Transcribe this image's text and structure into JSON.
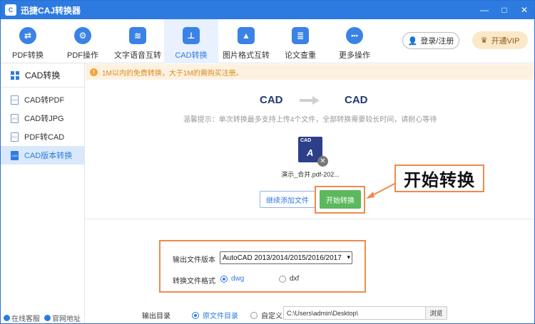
{
  "app": {
    "title": "迅捷CAJ转换器",
    "logo": "C"
  },
  "window": {
    "minimize": "—",
    "maximize": "□",
    "close": "✕"
  },
  "toolbar": {
    "tabs": [
      {
        "label": "PDF转换",
        "icon": "⇄"
      },
      {
        "label": "PDF操作",
        "icon": "⚙"
      },
      {
        "label": "文字语音互转",
        "icon": "≋"
      },
      {
        "label": "CAD转换",
        "icon": "⊥"
      },
      {
        "label": "图片格式互转",
        "icon": "▲"
      },
      {
        "label": "论文查重",
        "icon": "≣"
      },
      {
        "label": "更多操作",
        "icon": "•••"
      }
    ],
    "login": "登录/注册",
    "vip": "开通VIP"
  },
  "sidebar": {
    "header": "CAD转换",
    "items": [
      {
        "label": "CAD转PDF",
        "badge": "PDF"
      },
      {
        "label": "CAD转JPG",
        "badge": "JPG"
      },
      {
        "label": "PDF转CAD",
        "badge": "PDF"
      },
      {
        "label": "CAD版本转换",
        "badge": "CAD"
      }
    ],
    "bottom": {
      "service": "在线客服",
      "site": "官网地址"
    }
  },
  "notice": {
    "icon": "!",
    "text": "1M以内的免费转换，大于1M的需购买注册。"
  },
  "conversion": {
    "from": "CAD",
    "to": "CAD",
    "tip": "温馨提示：单次转换最多支持上传4个文件，全部转换需要较长时间，请耐心等待",
    "file": {
      "type": "CAD",
      "glyph": "A",
      "name": "演示_合并.pdf-202...",
      "remove": "✕"
    },
    "add_button": "继续添加文件",
    "start_button": "开始转换"
  },
  "callout": "开始转换",
  "settings": {
    "version_label": "输出文件版本",
    "version_value": "AutoCAD 2013/2014/2015/2016/2017",
    "format_label": "转换文件格式",
    "format_options": [
      "dwg",
      "dxf"
    ],
    "format_selected": "dwg",
    "output_label": "输出目录",
    "output_options": [
      "原文件目录",
      "自定义"
    ],
    "output_selected": "原文件目录",
    "output_path": "C:\\Users\\admin\\Desktop\\",
    "browse": "浏览"
  },
  "colors": {
    "accent": "#2d7be0",
    "highlight": "#f08a4b",
    "start": "#5cb85c",
    "notice": "#d98a1c"
  }
}
